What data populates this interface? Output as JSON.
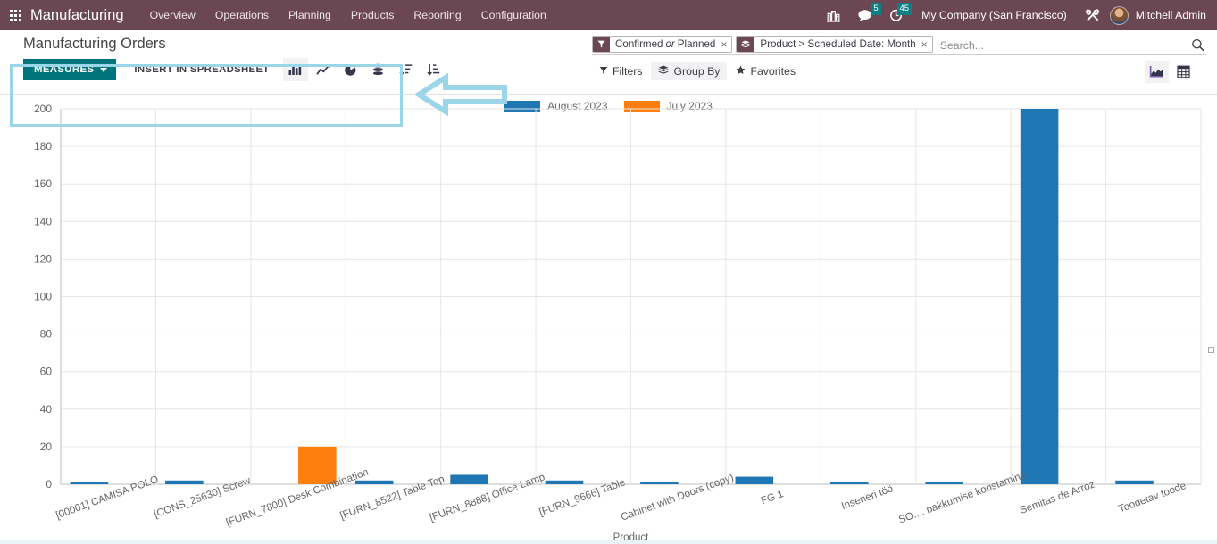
{
  "navbar": {
    "apps_icon": "grid-apps-icon",
    "brand": "Manufacturing",
    "menu": [
      {
        "label": "Overview"
      },
      {
        "label": "Operations"
      },
      {
        "label": "Planning"
      },
      {
        "label": "Products"
      },
      {
        "label": "Reporting"
      },
      {
        "label": "Configuration"
      }
    ],
    "right": {
      "enterprise_icon": "building-icon",
      "messages_icon": "chat-bubble-icon",
      "messages_count": "5",
      "activities_icon": "clock-icon",
      "activities_count": "45",
      "company": "My Company (San Francisco)",
      "debug_icon": "wrench-tools-icon",
      "user": "Mitchell Admin"
    }
  },
  "control_panel": {
    "title": "Manufacturing Orders",
    "measures_label": "MEASURES",
    "insert_spreadsheet_label": "INSERT IN SPREADSHEET",
    "chart_buttons": [
      {
        "name": "bar-chart-icon",
        "title": "Bar Chart",
        "active": true
      },
      {
        "name": "line-chart-icon",
        "title": "Line Chart",
        "active": false
      },
      {
        "name": "pie-chart-icon",
        "title": "Pie Chart",
        "active": false
      },
      {
        "name": "stacked-icon",
        "title": "Stacked",
        "active": false
      },
      {
        "name": "sort-descending-icon",
        "title": "Descending",
        "active": false
      },
      {
        "name": "sort-ascending-icon",
        "title": "Ascending",
        "active": false
      }
    ],
    "search": {
      "placeholder": "Search...",
      "value": "",
      "facets": [
        {
          "icon": "filter-funnel-icon",
          "pre": "Confirmed",
          "em": "or",
          "post": "Planned",
          "remove": "×"
        },
        {
          "icon": "group-layers-icon",
          "pre": "Product > Scheduled Date: Month",
          "em": "",
          "post": "",
          "remove": "×"
        }
      ]
    },
    "filters": [
      {
        "label": "Filters",
        "icon": "filter-funnel-icon",
        "active": false
      },
      {
        "label": "Group By",
        "icon": "group-layers-icon",
        "active": true
      },
      {
        "label": "Favorites",
        "icon": "star-icon",
        "active": false
      }
    ],
    "views": [
      {
        "name": "graph-view-icon",
        "label": "Graph",
        "active": true
      },
      {
        "name": "pivot-view-icon",
        "label": "Pivot",
        "active": false
      }
    ],
    "annotation": {
      "highlight_color": "#9BD6E8",
      "arrow_color": "#9BD6E8",
      "arrow_direction": "left"
    }
  },
  "chart_data": {
    "type": "bar",
    "title": "",
    "xlabel": "Product",
    "ylabel": "",
    "ylim": [
      0,
      200
    ],
    "yticks": [
      0,
      20,
      40,
      60,
      80,
      100,
      120,
      140,
      160,
      180,
      200
    ],
    "grid": true,
    "legend_position": "top",
    "categories": [
      "[00001] CAMISA POLO",
      "[CONS_25630] Screw",
      "[FURN_7800] Desk Combination",
      "[FURN_8522] Table Top",
      "[FURN_8888] Office Lamp",
      "[FURN_9666] Table",
      "Cabinet with Doors (copy)",
      "FG 1",
      "Inseneri töö",
      "SO.... pakkumise koostamine",
      "Semitas de Arroz",
      "Toodetav toode"
    ],
    "series": [
      {
        "name": "August 2023",
        "color": "#1F77B4",
        "values": [
          1,
          2,
          0,
          2,
          5,
          2,
          1,
          4,
          1,
          1,
          200,
          2
        ]
      },
      {
        "name": "July 2023",
        "color": "#FF7F0E",
        "values": [
          0,
          0,
          20,
          0,
          0,
          0,
          0,
          0,
          0,
          0,
          0,
          0
        ]
      }
    ]
  }
}
